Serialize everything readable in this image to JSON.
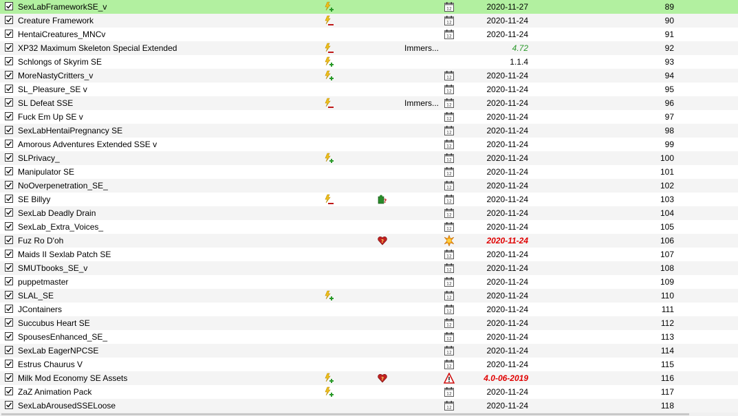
{
  "rows": [
    {
      "name": "SexLabFrameworkSE_v",
      "flag": "flag-plus-icon",
      "category": "",
      "content": "",
      "status": "calendar-icon",
      "version": "2020-11-27",
      "version_style": "normal",
      "priority": "89",
      "selected": true
    },
    {
      "name": "Creature Framework",
      "flag": "flag-minus-icon",
      "category": "",
      "content": "",
      "status": "calendar-icon",
      "version": "2020-11-24",
      "version_style": "normal",
      "priority": "90"
    },
    {
      "name": "HentaiCreatures_MNCv",
      "flag": "",
      "category": "",
      "content": "",
      "status": "calendar-icon",
      "version": "2020-11-24",
      "version_style": "normal",
      "priority": "91"
    },
    {
      "name": "XP32 Maximum Skeleton Special Extended",
      "flag": "flag-minus-icon",
      "category": "Immers...",
      "content": "",
      "status": "",
      "version": "4.72",
      "version_style": "green",
      "priority": "92"
    },
    {
      "name": "Schlongs of Skyrim SE",
      "flag": "flag-plus-icon",
      "category": "",
      "content": "",
      "status": "",
      "version": "1.1.4",
      "version_style": "normal",
      "priority": "93"
    },
    {
      "name": "MoreNastyCritters_v",
      "flag": "flag-plus-icon",
      "category": "",
      "content": "",
      "status": "calendar-icon",
      "version": "2020-11-24",
      "version_style": "normal",
      "priority": "94"
    },
    {
      "name": "SL_Pleasure_SE v",
      "flag": "",
      "category": "",
      "content": "",
      "status": "calendar-icon",
      "version": "2020-11-24",
      "version_style": "normal",
      "priority": "95"
    },
    {
      "name": "SL Defeat SSE",
      "flag": "flag-minus-icon",
      "category": "Immers...",
      "content": "",
      "status": "calendar-icon",
      "version": "2020-11-24",
      "version_style": "normal",
      "priority": "96"
    },
    {
      "name": "Fuck Em Up SE v",
      "flag": "",
      "category": "",
      "content": "",
      "status": "calendar-icon",
      "version": "2020-11-24",
      "version_style": "normal",
      "priority": "97"
    },
    {
      "name": "SexLabHentaiPregnancy SE",
      "flag": "",
      "category": "",
      "content": "",
      "status": "calendar-icon",
      "version": "2020-11-24",
      "version_style": "normal",
      "priority": "98"
    },
    {
      "name": "Amorous Adventures Extended SSE v",
      "flag": "",
      "category": "",
      "content": "",
      "status": "calendar-icon",
      "version": "2020-11-24",
      "version_style": "normal",
      "priority": "99"
    },
    {
      "name": "SLPrivacy_",
      "flag": "flag-plus-icon",
      "category": "",
      "content": "",
      "status": "calendar-icon",
      "version": "2020-11-24",
      "version_style": "normal",
      "priority": "100"
    },
    {
      "name": "Manipulator SE",
      "flag": "",
      "category": "",
      "content": "",
      "status": "calendar-icon",
      "version": "2020-11-24",
      "version_style": "normal",
      "priority": "101"
    },
    {
      "name": "NoOverpenetration_SE_",
      "flag": "",
      "category": "",
      "content": "",
      "status": "calendar-icon",
      "version": "2020-11-24",
      "version_style": "normal",
      "priority": "102"
    },
    {
      "name": "SE Billyy",
      "flag": "flag-minus-icon",
      "category": "",
      "content": "puzzle-question-icon",
      "status": "calendar-icon",
      "version": "2020-11-24",
      "version_style": "normal",
      "priority": "103"
    },
    {
      "name": "SexLab Deadly Drain",
      "flag": "",
      "category": "",
      "content": "",
      "status": "calendar-icon",
      "version": "2020-11-24",
      "version_style": "normal",
      "priority": "104"
    },
    {
      "name": "SexLab_Extra_Voices_",
      "flag": "",
      "category": "",
      "content": "",
      "status": "calendar-icon",
      "version": "2020-11-24",
      "version_style": "normal",
      "priority": "105"
    },
    {
      "name": "Fuz Ro D'oh",
      "flag": "",
      "category": "",
      "content": "heart-question-icon",
      "status": "sun-update-icon",
      "version": "2020-11-24",
      "version_style": "red",
      "priority": "106"
    },
    {
      "name": "Maids II Sexlab Patch SE",
      "flag": "",
      "category": "",
      "content": "",
      "status": "calendar-icon",
      "version": "2020-11-24",
      "version_style": "normal",
      "priority": "107"
    },
    {
      "name": "SMUTbooks_SE_v",
      "flag": "",
      "category": "",
      "content": "",
      "status": "calendar-icon",
      "version": "2020-11-24",
      "version_style": "normal",
      "priority": "108"
    },
    {
      "name": "puppetmaster",
      "flag": "",
      "category": "",
      "content": "",
      "status": "calendar-icon",
      "version": "2020-11-24",
      "version_style": "normal",
      "priority": "109"
    },
    {
      "name": "SLAL_SE",
      "flag": "flag-plus-icon",
      "category": "",
      "content": "",
      "status": "calendar-icon",
      "version": "2020-11-24",
      "version_style": "normal",
      "priority": "110"
    },
    {
      "name": "JContainers",
      "flag": "",
      "category": "",
      "content": "",
      "status": "calendar-icon",
      "version": "2020-11-24",
      "version_style": "normal",
      "priority": "111"
    },
    {
      "name": "Succubus Heart SE",
      "flag": "",
      "category": "",
      "content": "",
      "status": "calendar-icon",
      "version": "2020-11-24",
      "version_style": "normal",
      "priority": "112"
    },
    {
      "name": "SpousesEnhanced_SE_",
      "flag": "",
      "category": "",
      "content": "",
      "status": "calendar-icon",
      "version": "2020-11-24",
      "version_style": "normal",
      "priority": "113"
    },
    {
      "name": "SexLab EagerNPCSE",
      "flag": "",
      "category": "",
      "content": "",
      "status": "calendar-icon",
      "version": "2020-11-24",
      "version_style": "normal",
      "priority": "114"
    },
    {
      "name": "Estrus Chaurus V",
      "flag": "",
      "category": "",
      "content": "",
      "status": "calendar-icon",
      "version": "2020-11-24",
      "version_style": "normal",
      "priority": "115"
    },
    {
      "name": "Milk Mod Economy SE Assets",
      "flag": "flag-plus-icon",
      "category": "",
      "content": "heart-question-icon",
      "status": "warning-icon",
      "version": "4.0-06-2019",
      "version_style": "red",
      "priority": "116"
    },
    {
      "name": "ZaZ Animation Pack",
      "flag": "flag-plus-icon",
      "category": "",
      "content": "",
      "status": "calendar-icon",
      "version": "2020-11-24",
      "version_style": "normal",
      "priority": "117"
    },
    {
      "name": "SexLabArousedSSELoose",
      "flag": "",
      "category": "",
      "content": "",
      "status": "calendar-icon",
      "version": "2020-11-24",
      "version_style": "normal",
      "priority": "118"
    }
  ],
  "colors": {
    "selected_row": "#b2f0a0",
    "version_outdated": "#e00000",
    "version_newer": "#2e9a2e"
  }
}
